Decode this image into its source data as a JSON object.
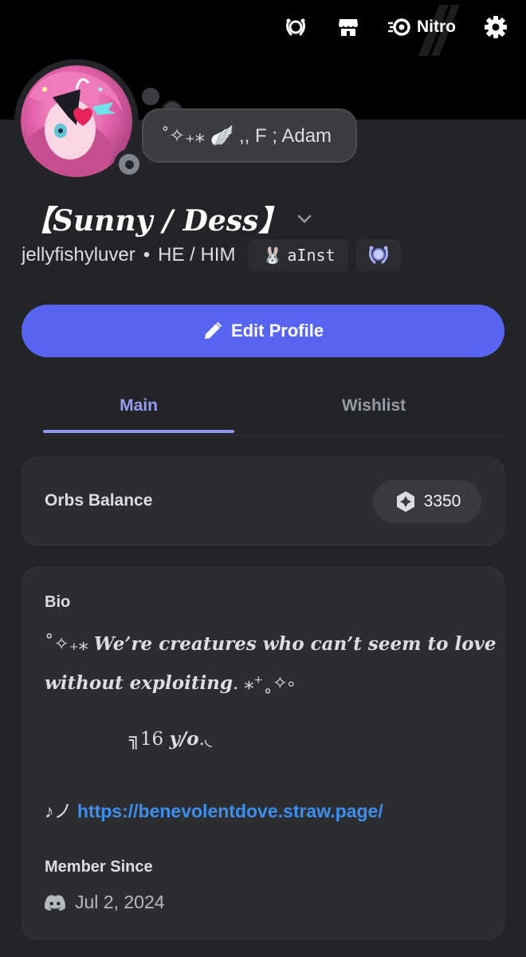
{
  "topbar": {
    "nitro_label": "Nitro"
  },
  "profile": {
    "custom_status": "˚✧₊⁎ 🪽 ,, F ; Adam",
    "display_name": "【Sunny / Dess】",
    "username": "jellyfishyluver",
    "separator": "•",
    "pronouns": "HE / HIM",
    "tag_emoji": "🐰",
    "tag": "aInst",
    "status_color": "#80848e"
  },
  "actions": {
    "edit_profile": "Edit Profile"
  },
  "tabs": [
    {
      "label": "Main"
    },
    {
      "label": "Wishlist"
    }
  ],
  "orbs": {
    "label": "Orbs Balance",
    "value": "3350"
  },
  "bio": {
    "label": "Bio",
    "line1_prefix": "˚✧₊⁎ ",
    "line1": "We’re creatures who can’t seem to love",
    "line2": "without exploiting",
    "line2_suffix": ". ⁎⁺˳✧༚",
    "age_prefix": "╗16 ",
    "age": "y/o",
    "age_suffix": ".◟",
    "link_prefix": "♪ノ ",
    "link": "https://benevolentdove.straw.page/"
  },
  "member_since": {
    "label": "Member Since",
    "date": "Jul 2, 2024"
  },
  "colors": {
    "accent": "#5865f2",
    "tab_active": "#949cf7",
    "link": "#3c8ef0"
  }
}
